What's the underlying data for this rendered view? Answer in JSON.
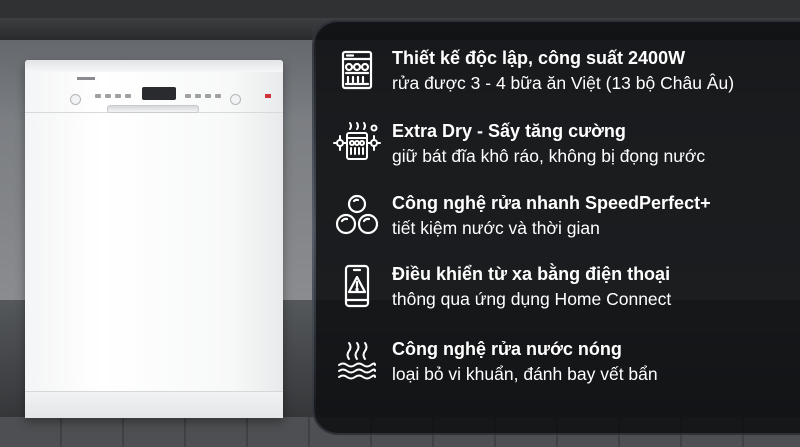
{
  "features": [
    {
      "icon": "dish-rack-icon",
      "title": "Thiết kế độc lập, công suất 2400W",
      "subtitle": "rửa được 3 - 4 bữa ăn Việt (13 bộ Châu Âu)"
    },
    {
      "icon": "extra-dry-icon",
      "title": "Extra Dry - Sấy tăng cường",
      "subtitle": "giữ bát đĩa khô ráo, không bị đọng nước"
    },
    {
      "icon": "speed-perfect-icon",
      "title": "Công nghệ rửa nhanh SpeedPerfect+",
      "subtitle": "tiết kiệm nước và thời gian"
    },
    {
      "icon": "smartphone-alert-icon",
      "title": "Điều khiển từ xa bằng điện thoại",
      "subtitle": "thông qua ứng dụng Home Connect"
    },
    {
      "icon": "hot-water-icon",
      "title": "Công nghệ rửa nước nóng",
      "subtitle": "loại bỏ vi khuẩn, đánh bay vết bẩn"
    }
  ],
  "colors": {
    "card_bg": "#101113",
    "text": "#ffffff",
    "dishwasher_body": "#f6f7f8"
  }
}
